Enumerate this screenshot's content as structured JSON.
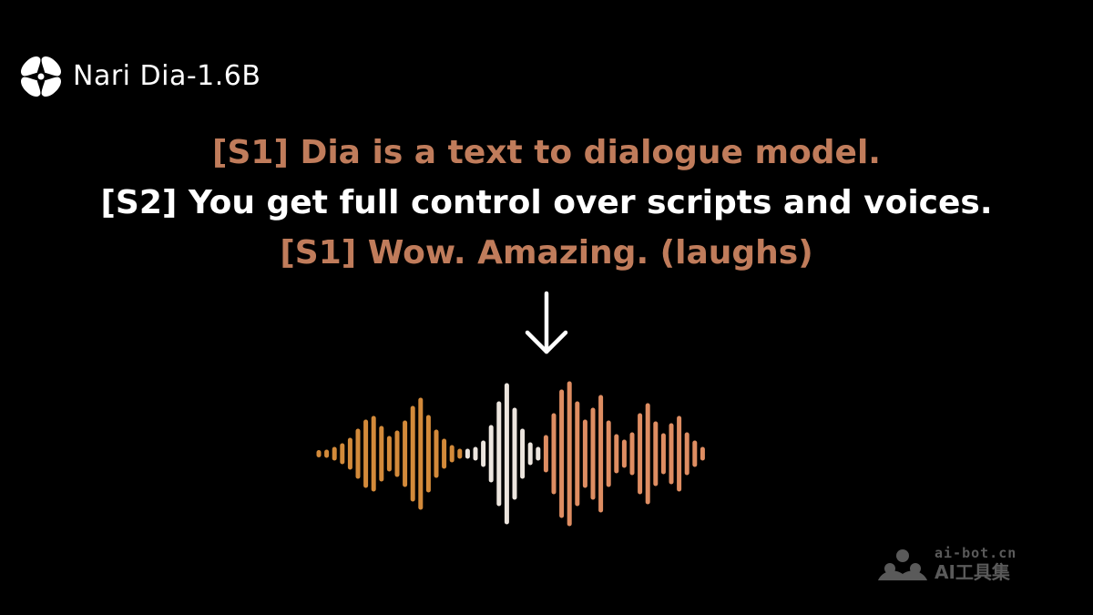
{
  "brand": {
    "icon": "flower-logo-icon",
    "name": "Nari Dia-1.6B"
  },
  "script": {
    "lines": [
      {
        "speaker": "S1",
        "text": "[S1] Dia is a text to dialogue model.",
        "color": "#c07c5b"
      },
      {
        "speaker": "S2",
        "text": "[S2] You get full control over scripts and voices.",
        "color": "#ffffff"
      },
      {
        "speaker": "S1",
        "text": "[S1] Wow. Amazing. (laughs)",
        "color": "#c07c5b"
      }
    ]
  },
  "arrow": {
    "icon": "arrow-down-icon",
    "color": "#ffffff"
  },
  "waveform": {
    "icon": "audio-waveform-icon",
    "colors": {
      "s1_orange": "#d38a3a",
      "s2_white": "#ece5de",
      "s1_salmon": "#de8d62"
    }
  },
  "watermark": {
    "icon": "ai-bot-logo-icon",
    "domain": "ai-bot.cn",
    "name": "AI工具集",
    "color": "#5a5a5a"
  }
}
